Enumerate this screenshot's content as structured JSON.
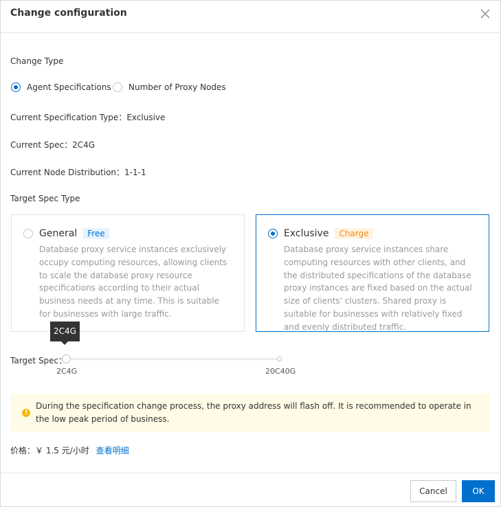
{
  "dialog": {
    "title": "Change configuration",
    "change_type_label": "Change Type",
    "change_type_options": [
      {
        "label": "Agent Specifications",
        "selected": true
      },
      {
        "label": "Number of Proxy Nodes",
        "selected": false
      }
    ],
    "current_spec_type_label": "Current Specification Type：",
    "current_spec_type_value": "Exclusive",
    "current_spec_label": "Current Spec：",
    "current_spec_value": "2C4G",
    "current_node_dist_label": "Current Node Distribution：",
    "current_node_dist_value": "1-1-1",
    "target_spec_type_label": "Target Spec Type",
    "spec_types": [
      {
        "name": "General",
        "badge": "Free",
        "selected": false,
        "description": "Database proxy service instances exclusively occupy computing resources, allowing clients to scale the database proxy resource specifications according to their actual business needs at any time. This is suitable for businesses with large traffic."
      },
      {
        "name": "Exclusive",
        "badge": "Charge",
        "selected": true,
        "description": "Database proxy service instances share computing resources with other clients, and the distributed specifications of the database proxy instances are fixed based on the actual size of clients' clusters. Shared proxy is suitable for businesses with relatively fixed and evenly distributed traffic."
      }
    ],
    "target_spec_label": "Target Spec：",
    "slider": {
      "tooltip": "2C4G",
      "min_label": "2C4G",
      "max_label": "20C40G",
      "value_fraction": 0
    },
    "notice": "During the specification change process, the proxy address will flash off. It is recommended to operate in the low peak period of business.",
    "price_label": "价格：￥ 1.5 元/小时",
    "price_detail_link": "查看明细",
    "buttons": {
      "cancel": "Cancel",
      "ok": "OK"
    },
    "colors": {
      "primary": "#0070cc",
      "warning": "#f5b90a",
      "notice_bg": "#fffbe6"
    }
  }
}
